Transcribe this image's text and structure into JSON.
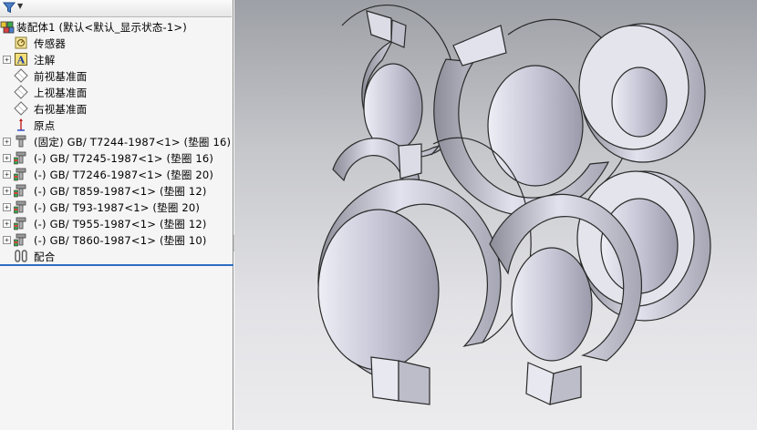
{
  "feature_tree": {
    "filter_icon": "filter-icon",
    "root": {
      "label": "装配体1 (默认<默认_显示状态-1>)",
      "icon": "assembly-icon"
    },
    "items": [
      {
        "label": "传感器",
        "icon": "sensor-icon",
        "expandable": false
      },
      {
        "label": "注解",
        "icon": "annotation-icon",
        "expandable": true
      },
      {
        "label": "前视基准面",
        "icon": "plane-icon",
        "expandable": false
      },
      {
        "label": "上视基准面",
        "icon": "plane-icon",
        "expandable": false
      },
      {
        "label": "右视基准面",
        "icon": "plane-icon",
        "expandable": false
      },
      {
        "label": "原点",
        "icon": "origin-icon",
        "expandable": false
      },
      {
        "label": "(固定) GB/ T7244-1987<1> (垫圈 16)",
        "icon": "part-icon",
        "expandable": true
      },
      {
        "label": "(-) GB/ T7245-1987<1> (垫圈 16)",
        "icon": "part-icon",
        "expandable": true
      },
      {
        "label": "(-) GB/ T7246-1987<1> (垫圈 20)",
        "icon": "part-icon",
        "expandable": true
      },
      {
        "label": "(-) GB/ T859-1987<1> (垫圈 12)",
        "icon": "part-icon",
        "expandable": true
      },
      {
        "label": "(-) GB/ T93-1987<1> (垫圈 20)",
        "icon": "part-icon",
        "expandable": true
      },
      {
        "label": "(-) GB/ T955-1987<1> (垫圈 12)",
        "icon": "part-icon",
        "expandable": true
      },
      {
        "label": "(-) GB/ T860-1987<1> (垫圈 10)",
        "icon": "part-icon",
        "expandable": true
      },
      {
        "label": "配合",
        "icon": "mates-icon",
        "expandable": false
      }
    ]
  },
  "colors": {
    "panel_bg": "#f5f5f5",
    "selection_line": "#2f6dc0",
    "washer_face": "#e4e4ec",
    "washer_side": "#b4b4c2",
    "washer_edge": "#2a2a2a"
  }
}
